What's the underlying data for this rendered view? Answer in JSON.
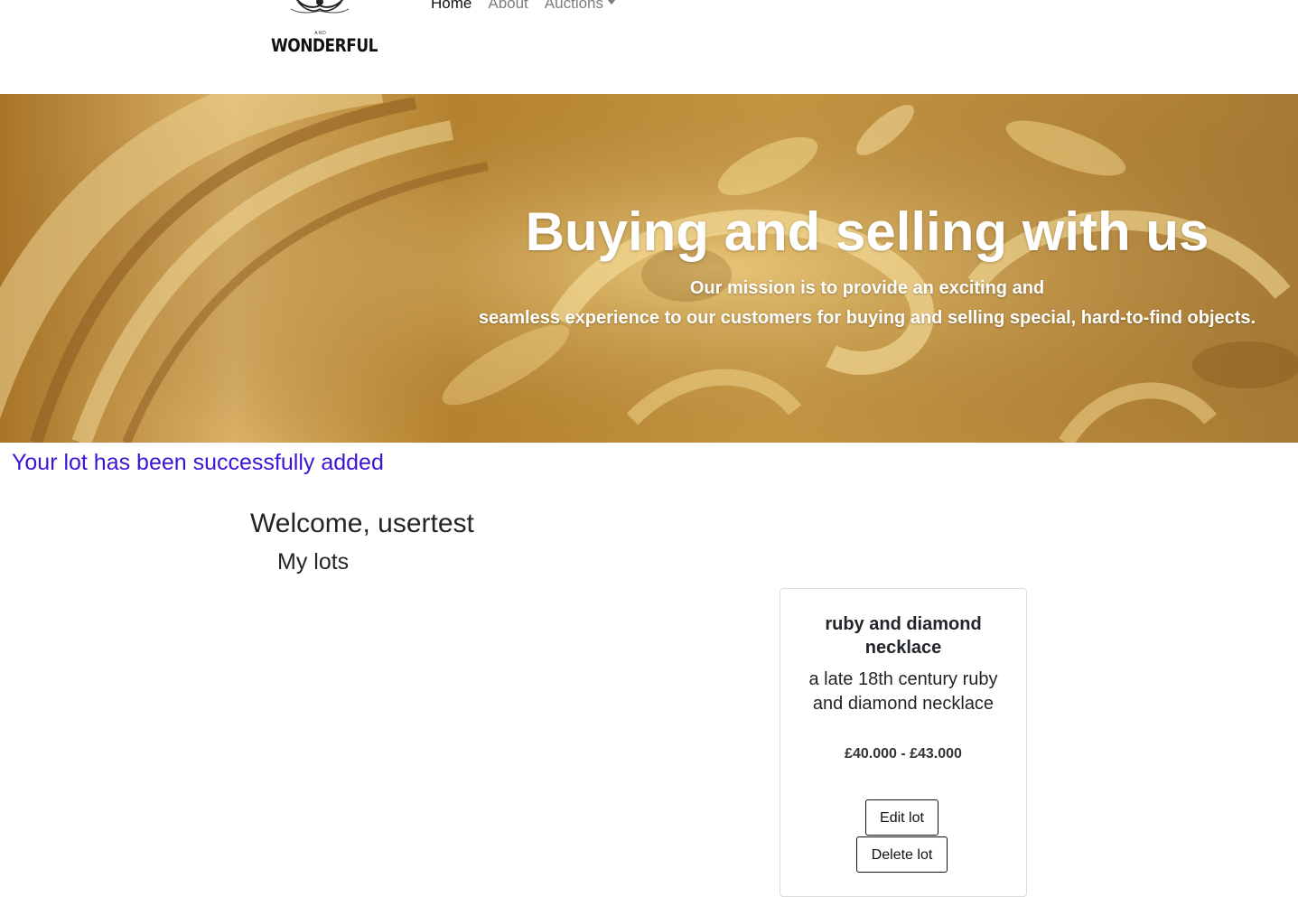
{
  "brand": {
    "logo_small_text": "AND",
    "logo_word": "WONDERFUL"
  },
  "nav": {
    "items": [
      {
        "label": "Home",
        "active": true
      },
      {
        "label": "About",
        "active": false
      },
      {
        "label": "Auctions",
        "active": false,
        "has_dropdown": true
      }
    ]
  },
  "hero": {
    "title": "Buying and selling with us",
    "subtitle_line1": "Our mission is to provide an exciting and",
    "subtitle_line2": "seamless experience to our customers for buying and selling special, hard-to-find objects."
  },
  "flash_message": "Your lot has been successfully added",
  "welcome": {
    "text": "Welcome, usertest"
  },
  "section_title": "My lots",
  "lots": [
    {
      "title": "ruby and diamond necklace",
      "description": "a late 18th century ruby and diamond necklace",
      "price_range": "£40.000 - £43.000",
      "edit_label": "Edit lot",
      "delete_label": "Delete lot"
    }
  ],
  "colors": {
    "flash": "#3b14d4",
    "nav_inactive": "#7d7d7d",
    "hero_gold": "#c9a24a"
  }
}
